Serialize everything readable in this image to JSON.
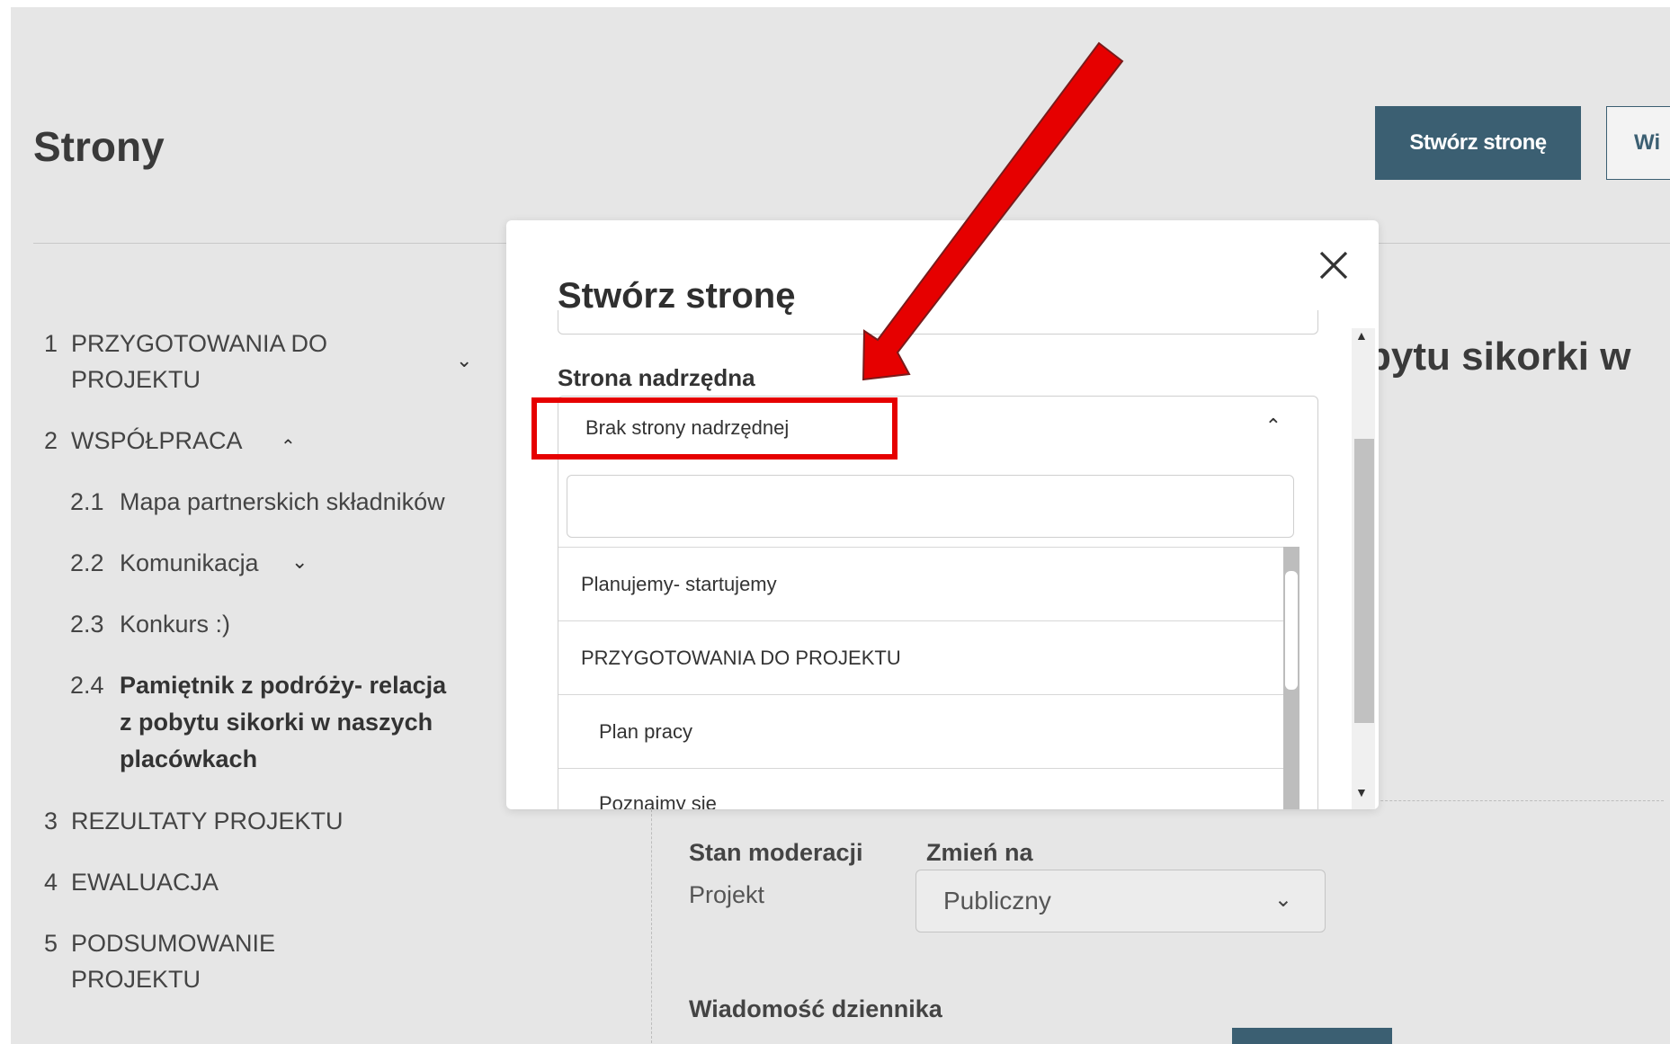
{
  "header": {
    "title": "Strony",
    "create_button": "Stwórz stronę",
    "secondary_button": "Wi"
  },
  "nav": {
    "items": [
      {
        "num": "1",
        "text": "PRZYGOTOWANIA DO",
        "text2": "PROJEKTU"
      },
      {
        "num": "2",
        "text": "WSPÓŁPRACA"
      },
      {
        "num": "2.1",
        "text": "Mapa partnerskich składników"
      },
      {
        "num": "2.2",
        "text": "Komunikacja"
      },
      {
        "num": "2.3",
        "text": "Konkurs :)"
      },
      {
        "num": "2.4",
        "text": "Pamiętnik z podróży- relacja",
        "text2": "z pobytu sikorki w naszych",
        "text3": "placówkach"
      },
      {
        "num": "3",
        "text": "REZULTATY PROJEKTU"
      },
      {
        "num": "4",
        "text": "EWALUACJA"
      },
      {
        "num": "5",
        "text": "PODSUMOWANIE",
        "text2": "PROJEKTU"
      }
    ]
  },
  "content": {
    "title_partial": "bytu sikorki w",
    "moderation_label": "Stan moderacji",
    "moderation_value": "Projekt",
    "change_label": "Zmień na",
    "change_value": "Publiczny",
    "log_label": "Wiadomość dziennika"
  },
  "modal": {
    "title": "Stwórz stronę",
    "parent_label": "Strona nadrzędna",
    "parent_selected": "Brak strony nadrzędnej",
    "search_value": "",
    "options": [
      "Planujemy- startujemy",
      "PRZYGOTOWANIA DO PROJEKTU",
      "Plan pracy",
      "Poznajmy się"
    ]
  },
  "annotation": {
    "arrow_color": "#e60000",
    "box_color": "#e60000"
  }
}
